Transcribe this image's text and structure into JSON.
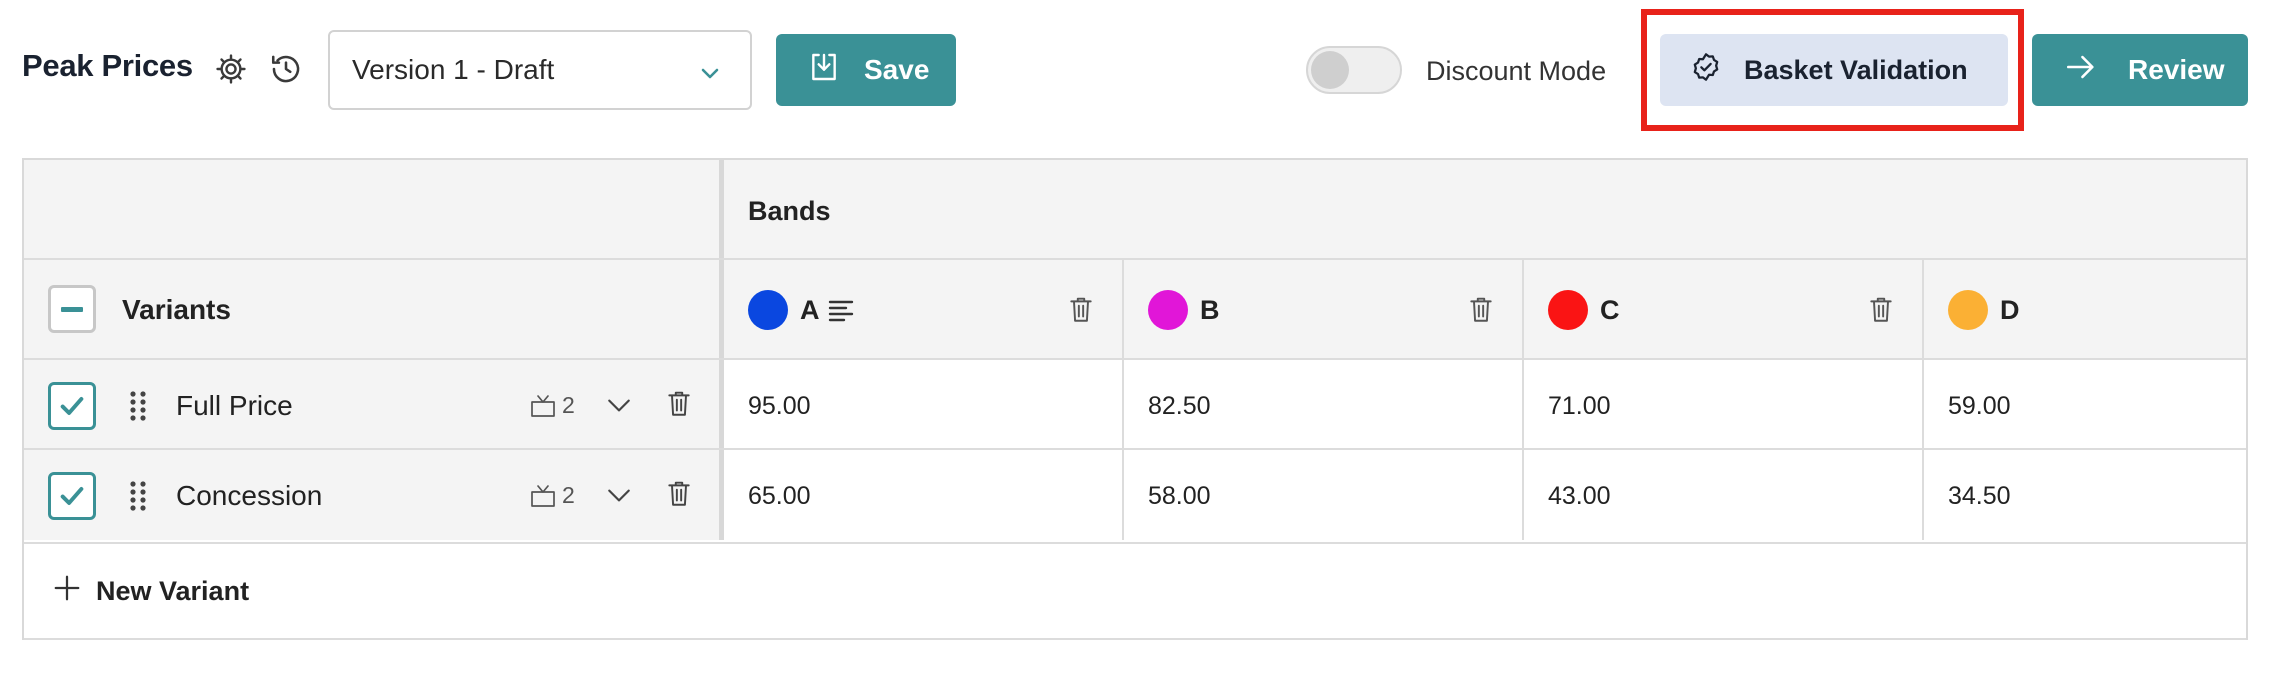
{
  "header": {
    "title": "Peak Prices",
    "version_select": {
      "value": "Version 1 - Draft"
    },
    "save_label": "Save",
    "discount_toggle": {
      "label": "Discount Mode",
      "on": false
    },
    "basket_validation_label": "Basket Validation",
    "review_label": "Review"
  },
  "colors": {
    "accent": "#3a9196",
    "basket_bg": "#dde4f2",
    "highlight": "#e8221a"
  },
  "grid": {
    "bands_header": "Bands",
    "variants_header": "Variants",
    "bands": [
      {
        "name": "A",
        "color": "#0a47e0",
        "has_description": true
      },
      {
        "name": "B",
        "color": "#e116d8",
        "has_description": false
      },
      {
        "name": "C",
        "color": "#fa1414",
        "has_description": false
      },
      {
        "name": "D",
        "color": "#fbb034",
        "has_description": false
      }
    ],
    "variants": [
      {
        "name": "Full Price",
        "checked": true,
        "badge_count": "2",
        "prices": [
          "95.00",
          "82.50",
          "71.00",
          "59.00"
        ]
      },
      {
        "name": "Concession",
        "checked": true,
        "badge_count": "2",
        "prices": [
          "65.00",
          "58.00",
          "43.00",
          "34.50"
        ]
      }
    ],
    "new_variant_label": "New Variant"
  }
}
